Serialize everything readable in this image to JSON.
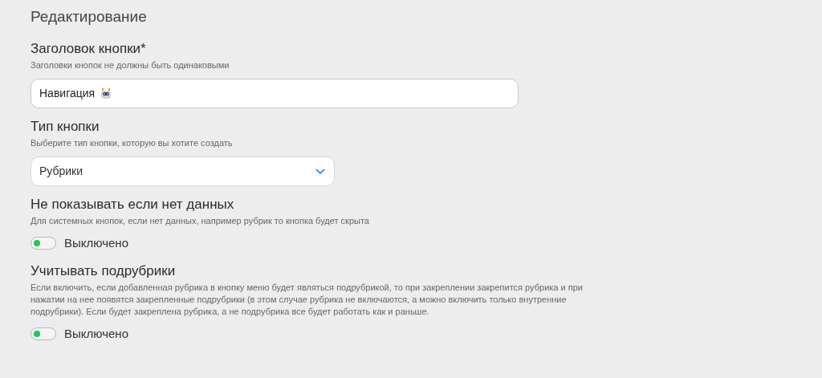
{
  "title": "Редактирование",
  "fields": [
    {
      "kind": "text",
      "label": "Заголовок кнопки*",
      "hint": "Заголовки кнопок не должны быть одинаковыми",
      "value": "Навигация"
    },
    {
      "kind": "select",
      "label": "Тип кнопки",
      "hint": "Выберите тип кнопки, которую вы хотите создать",
      "value": "Рубрики"
    },
    {
      "kind": "toggle",
      "label": "Не показывать если нет данных",
      "hint": "Для системных кнопок, если нет данных, например рубрик то кнопка будет скрыта",
      "on": false,
      "state_text": "Выключено"
    },
    {
      "kind": "toggle",
      "label": "Учитывать подрубрики",
      "hint": "Если включить, если добавленная рубрика в кнопку меню будет являться подрубрикой, то при закреплении закрепится рубрика и при нажатии на нее появятся закрепленные подрубрики (в этом случае рубрика не включаются, а можно включить только внутренние подрубрики). Если будет закреплена рубрика, а не подрубрика все будет работать как и раньше.",
      "on": false,
      "state_text": "Выключено"
    }
  ]
}
